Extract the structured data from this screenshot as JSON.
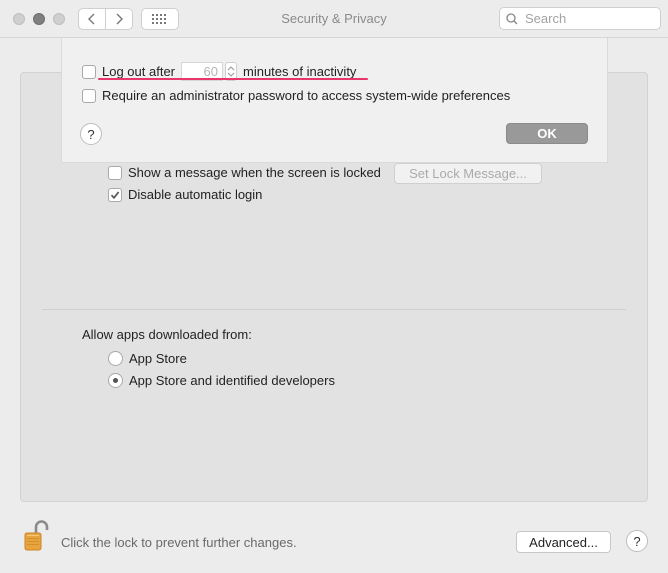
{
  "window": {
    "title": "Security & Privacy",
    "search_placeholder": "Search"
  },
  "sheet": {
    "logout_before": "Log out after",
    "logout_minutes": "60",
    "logout_after": "minutes of inactivity",
    "logout_checked": false,
    "require_admin": "Require an administrator password to access system-wide preferences",
    "require_admin_checked": false,
    "help": "?",
    "ok": "OK"
  },
  "general": {
    "show_message": "Show a message when the screen is locked",
    "show_message_checked": false,
    "set_lock_message": "Set Lock Message...",
    "disable_autologin": "Disable automatic login",
    "disable_autologin_checked": true
  },
  "apps": {
    "heading": "Allow apps downloaded from:",
    "options": [
      {
        "label": "App Store",
        "selected": false
      },
      {
        "label": "App Store and identified developers",
        "selected": true
      }
    ]
  },
  "footer": {
    "lock_text": "Click the lock to prevent further changes.",
    "advanced": "Advanced...",
    "help": "?"
  },
  "colors": {
    "annotation_underline": "#e8356c",
    "ok_button": "#999999"
  }
}
